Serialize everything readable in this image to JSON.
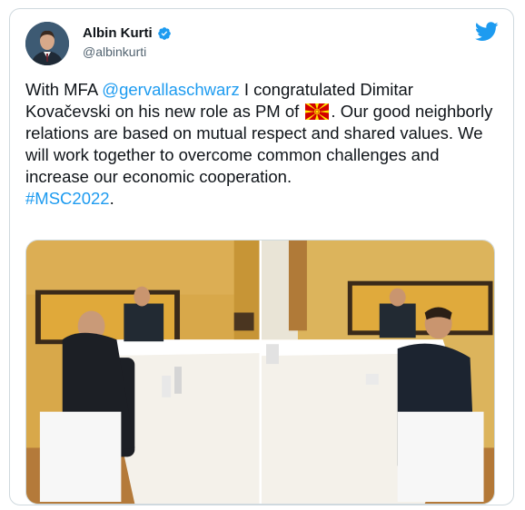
{
  "user": {
    "name": "Albin Kurti",
    "handle": "@albinkurti",
    "verified": true
  },
  "icons": {
    "avatar": "profile-photo",
    "verified": "verified-badge-icon",
    "brand": "twitter-bird-icon",
    "flag": "north-macedonia-flag-emoji"
  },
  "tweet": {
    "part1": "With MFA ",
    "mention": "@gervallaschwarz",
    "part2": " I congratulated Dimitar Kovačevski on his new role as PM of ",
    "part3": ". Our good neighborly relations are based on mutual respect and shared values. We will work together to overcome common challenges and increase our economic cooperation.",
    "hashtag": "#MSC2022",
    "part4": "."
  },
  "media": {
    "count": 2
  },
  "colors": {
    "accent": "#1d9bf0",
    "text": "#0f1419",
    "muted": "#536471",
    "border": "#cfd9de"
  }
}
